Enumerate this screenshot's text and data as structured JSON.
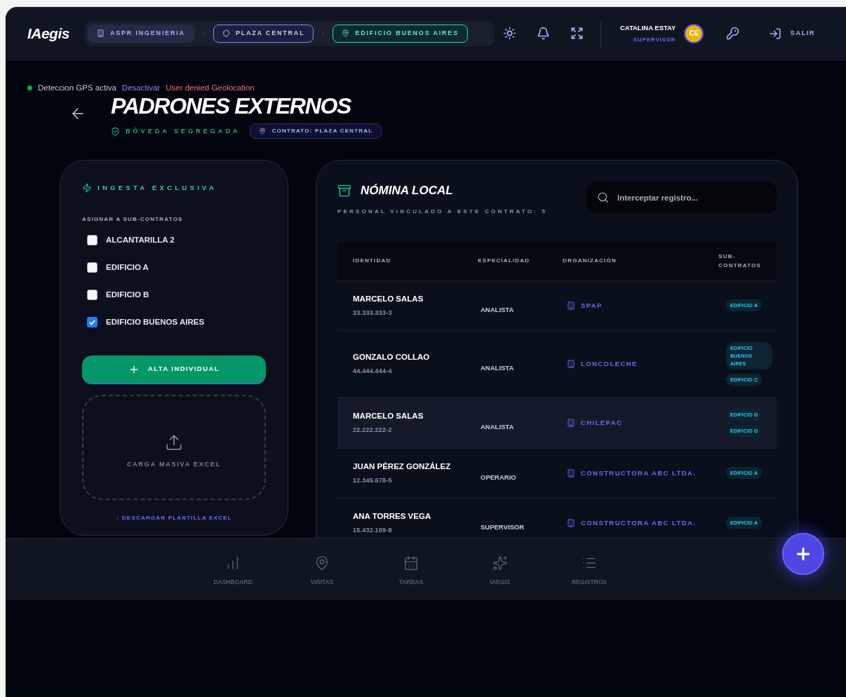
{
  "header": {
    "logo": "IAegis",
    "breadcrumbs": [
      {
        "label": "ASPR INGENIERIA",
        "kind": "company",
        "selected": false
      },
      {
        "label": "PLAZA CENTRAL",
        "kind": "contract",
        "selected": false
      },
      {
        "label": "EDIFICIO BUENOS AIRES",
        "kind": "site",
        "selected": true
      }
    ],
    "user": {
      "name": "CATALINA ESTAY",
      "role": "SUPERVISOR",
      "initials": "CE"
    },
    "logout": "SALIR"
  },
  "gps": {
    "status": "Deteccion GPS activa",
    "action": "Desactivar",
    "error": "User denied Geolocation"
  },
  "page": {
    "title": "PADRONES EXTERNOS",
    "vault": "BÓVEDA SEGREGADA",
    "contract": "CONTRATO: PLAZA CENTRAL"
  },
  "ingest": {
    "title": "INGESTA EXCLUSIVA",
    "assign_label": "ASIGNAR A SUB-CONTRATOS",
    "options": [
      {
        "label": "ALCANTARILLA 2",
        "checked": false
      },
      {
        "label": "EDIFICIO A",
        "checked": false
      },
      {
        "label": "EDIFICIO B",
        "checked": false
      },
      {
        "label": "EDIFICIO BUENOS AIRES",
        "checked": true
      }
    ],
    "add_button": "ALTA INDIVIDUAL",
    "upload": "CARGA MASIVA EXCEL",
    "template_link": "↓ DESCARGAR PLANTILLA EXCEL"
  },
  "roster": {
    "title": "NÓMINA LOCAL",
    "subtitle": "PERSONAL VINCULADO A ESTE CONTRATO: 5",
    "search": {
      "placeholder": "Interceptar registro..."
    },
    "columns": [
      "IDENTIDAD",
      "ESPECIALIDAD",
      "ORGANIZACIÓN",
      "SUB-CONTRATOS"
    ],
    "rows": [
      {
        "name": "MARCELO SALAS",
        "id": "33.333.333-3",
        "specialty": "ANALISTA",
        "org": "SPAP",
        "subcontracts": [
          "EDIFICIO A"
        ],
        "selected": false
      },
      {
        "name": "GONZALO COLLAO",
        "id": "44.444.444-4",
        "specialty": "ANALISTA",
        "org": "LONCOLECHE",
        "subcontracts": [
          "EDIFICIO BUENOS AIRES",
          "EDIFICIO C"
        ],
        "selected": false
      },
      {
        "name": "MARCELO SALAS",
        "id": "22.222.222-2",
        "specialty": "ANALISTA",
        "org": "CHILEPAC",
        "subcontracts": [
          "EDIFICIO D",
          "EDIFICIO D"
        ],
        "selected": true
      },
      {
        "name": "JUAN PÉREZ GONZÁLEZ",
        "id": "12.345.678-5",
        "specialty": "OPERARIO",
        "org": "CONSTRUCTORA ABC LTDA.",
        "subcontracts": [
          "EDIFICIO A"
        ],
        "selected": false
      },
      {
        "name": "ANA TORRES VEGA",
        "id": "15.432.109-8",
        "specialty": "SUPERVISOR",
        "org": "CONSTRUCTORA ABC LTDA.",
        "subcontracts": [
          "EDIFICIO A"
        ],
        "selected": false
      }
    ]
  },
  "nav": [
    {
      "label": "DASHBOARD",
      "kind": "dashboard"
    },
    {
      "label": "VISITAS",
      "kind": "visits"
    },
    {
      "label": "TAREAS",
      "kind": "tasks"
    },
    {
      "label": "IAEGIS",
      "kind": "ai"
    },
    {
      "label": "REGISTROS",
      "kind": "records"
    }
  ]
}
